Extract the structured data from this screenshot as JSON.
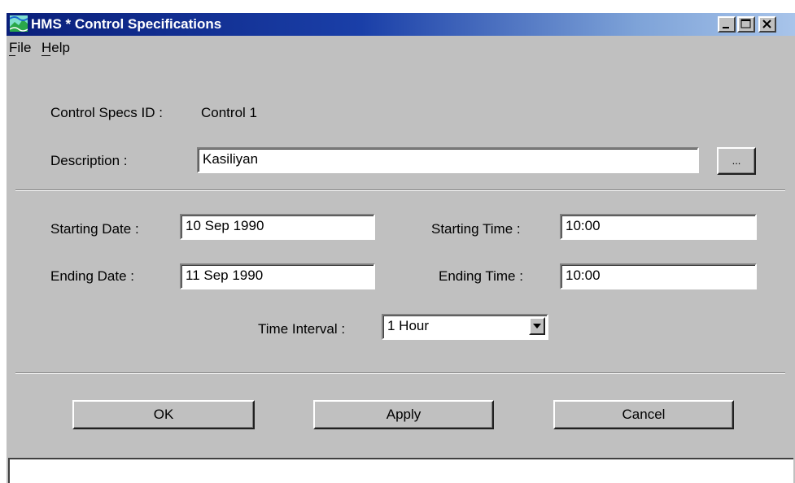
{
  "window": {
    "title": "HMS * Control Specifications"
  },
  "menu": {
    "items": [
      {
        "label": "File"
      },
      {
        "label": "Help"
      }
    ]
  },
  "form": {
    "control_specs_id_label": "Control Specs ID :",
    "control_specs_id_value": "Control 1",
    "description_label": "Description :",
    "description_value": "Kasiliyan",
    "ellipsis_label": "...",
    "starting_date_label": "Starting Date :",
    "starting_date_value": "10 Sep 1990",
    "starting_time_label": "Starting Time :",
    "starting_time_value": "10:00",
    "ending_date_label": "Ending Date :",
    "ending_date_value": "11 Sep 1990",
    "ending_time_label": "Ending Time :",
    "ending_time_value": "10:00",
    "time_interval_label": "Time Interval :",
    "time_interval_value": "1 Hour"
  },
  "buttons": {
    "ok_label": "OK",
    "apply_label": "Apply",
    "cancel_label": "Cancel"
  },
  "status": {
    "text": ""
  }
}
